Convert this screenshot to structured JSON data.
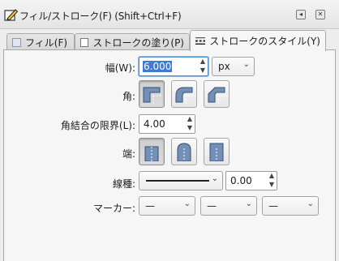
{
  "window": {
    "title": "フィル/ストローク(F) (Shift+Ctrl+F)",
    "controls": [
      "◂",
      "✕"
    ]
  },
  "tabs": [
    {
      "label": "フィル(F)",
      "icon": "fill-swatch-icon",
      "active": false
    },
    {
      "label": "ストロークの塗り(P)",
      "icon": "stroke-swatch-icon",
      "active": false
    },
    {
      "label": "ストロークのスタイル(Y)",
      "icon": "stroke-style-icon",
      "active": true
    }
  ],
  "stroke_style": {
    "width": {
      "label": "幅(W):",
      "value": "6.000",
      "unit": "px"
    },
    "join": {
      "label": "角:",
      "options": [
        "miter-join-icon",
        "round-join-icon",
        "bevel-join-icon"
      ],
      "selected": "miter-join-icon"
    },
    "miter_limit": {
      "label": "角結合の限界(L):",
      "value": "4.00"
    },
    "cap": {
      "label": "端:",
      "options": [
        "butt-cap-icon",
        "round-cap-icon",
        "square-cap-icon"
      ],
      "selected": "butt-cap-icon"
    },
    "dashes": {
      "label": "線種:",
      "offset": "0.00"
    },
    "markers": {
      "label": "マーカー:",
      "start": "—",
      "mid": "—",
      "end": "—"
    }
  },
  "colors": {
    "accent": "#3d7bd5",
    "icon_fill": "#7391b8"
  }
}
